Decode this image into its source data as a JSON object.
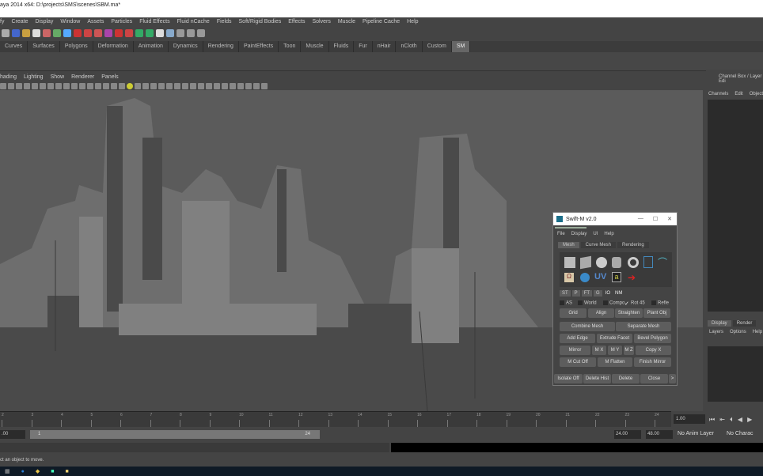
{
  "window_title": "aya 2014 x64: D:\\projects\\SMS\\scenes\\SBM.ma*",
  "menus": [
    "fy",
    "Create",
    "Display",
    "Window",
    "Assets",
    "Particles",
    "Fluid Effects",
    "Fluid nCache",
    "Fields",
    "Soft/Rigid Bodies",
    "Effects",
    "Solvers",
    "Muscle",
    "Pipeline Cache",
    "Help"
  ],
  "shelf_tabs": [
    "Curves",
    "Surfaces",
    "Polygons",
    "Deformation",
    "Animation",
    "Dynamics",
    "Rendering",
    "PaintEffects",
    "Toon",
    "Muscle",
    "Fluids",
    "Fur",
    "nHair",
    "nCloth",
    "Custom",
    "SM"
  ],
  "viewport_menus": [
    "hading",
    "Lighting",
    "Show",
    "Renderer",
    "Panels"
  ],
  "right_panel": {
    "title": "Channel Box / Layer Edi",
    "menus": [
      "Channels",
      "Edit",
      "Object"
    ],
    "tabs": [
      "Display",
      "Render"
    ],
    "layer_menus": [
      "Layers",
      "Options",
      "Help"
    ]
  },
  "timeline": {
    "ticks": [
      "2",
      "3",
      "4",
      "5",
      "6",
      "7",
      "8",
      "9",
      "10",
      "11",
      "12",
      "13",
      "14",
      "15",
      "16",
      "17",
      "18",
      "19",
      "20",
      "21",
      "22",
      "23",
      "24"
    ],
    "current_frame": "1.00"
  },
  "range": {
    "start": ".00",
    "slider_start": "1",
    "slider_end": "24",
    "end": "24.00",
    "total": "48.00",
    "anim_layer": "No Anim Layer",
    "character": "No Charac"
  },
  "help_line": "ct an object to move.",
  "swift": {
    "title": "Swift-M v2.0",
    "menus": [
      "File",
      "Display",
      "UI",
      "Help"
    ],
    "tabs": [
      "Mesh",
      "Curve Mesh",
      "Rendering"
    ],
    "small_buttons": [
      "ST",
      "P",
      "FT",
      "G"
    ],
    "labels": [
      "IO",
      "NM"
    ],
    "uv_label": "UV",
    "a_label": "a",
    "checks": [
      {
        "label": "AS",
        "checked": false
      },
      {
        "label": "World",
        "checked": false
      },
      {
        "label": "Compo",
        "checked": false
      },
      {
        "label": "Rot 45",
        "checked": true
      },
      {
        "label": "Refle",
        "checked": false
      }
    ],
    "row1": [
      "Grid",
      "Align",
      "Straighten",
      "Plant Obj"
    ],
    "row2": [
      "Combine Mesh",
      "Separate Mesh"
    ],
    "row3": [
      "Add Edge",
      "Extrude Facet",
      "Bevel Polygon"
    ],
    "row4": [
      "Mirror",
      "M X",
      "M Y",
      "M Z",
      "Copy X"
    ],
    "row5": [
      "M Cut Off",
      "M Flatten",
      "Finish Mirror"
    ],
    "bottom": [
      "Isolate Off",
      "Delete Hist",
      "Delete",
      "Close",
      ">"
    ]
  }
}
